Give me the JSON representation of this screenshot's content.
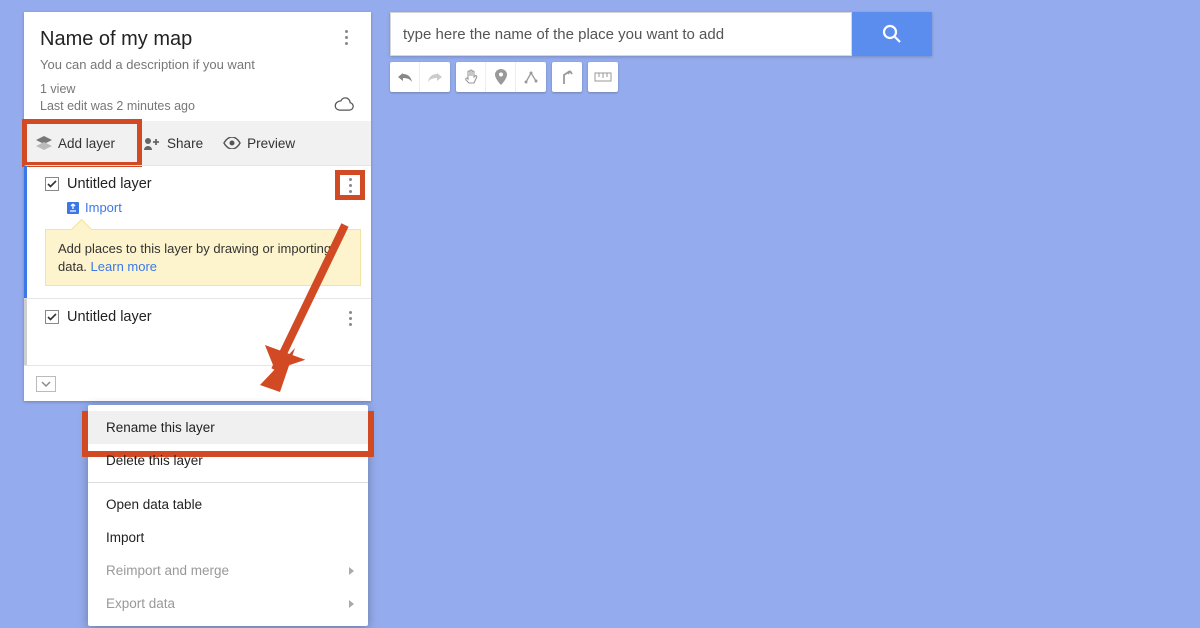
{
  "header": {
    "title": "Name of my map",
    "description": "You can add a description if you want",
    "views": "1 view",
    "last_edit": "Last edit was 2 minutes ago"
  },
  "actions": {
    "add_layer": "Add layer",
    "share": "Share",
    "preview": "Preview"
  },
  "layers": [
    {
      "name": "Untitled layer",
      "import_label": "Import",
      "tip_text": "Add places to this layer by drawing or importing data.",
      "tip_link": "Learn more"
    },
    {
      "name": "Untitled layer"
    }
  ],
  "context_menu": {
    "rename": "Rename this layer",
    "delete": "Delete this layer",
    "open_table": "Open data table",
    "import": "Import",
    "reimport": "Reimport and merge",
    "export": "Export data"
  },
  "search": {
    "placeholder": "type here the name of the place you want to add"
  },
  "icons": {
    "search": "search-icon",
    "undo": "undo-icon",
    "redo": "redo-icon",
    "hand": "hand-icon",
    "marker": "marker-icon",
    "line": "line-icon",
    "directions": "directions-icon",
    "ruler": "ruler-icon"
  }
}
